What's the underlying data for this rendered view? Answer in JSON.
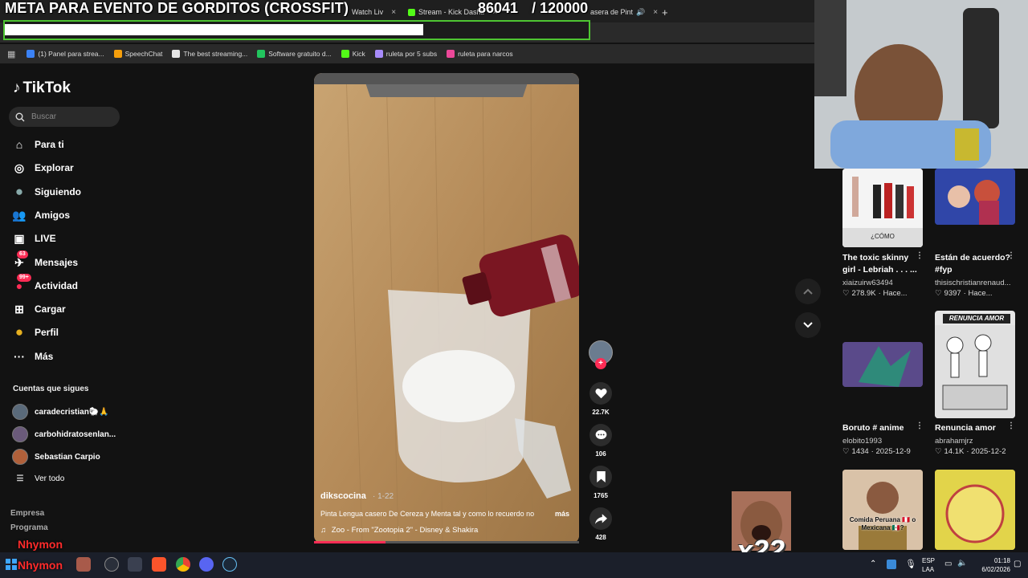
{
  "overlay": {
    "goal_title": "META PARA EVENTO DE GORDITOS (CROSSFIT)",
    "goal_current": "86041",
    "goal_separator": "/",
    "goal_target": "120000",
    "goal_progress": 0.717,
    "combo": "x22",
    "user_name": "Nhymon"
  },
  "browser": {
    "tabs": [
      {
        "label": "Watch Liv",
        "close": "×"
      },
      {
        "label": "Stream - Kick Dashb",
        "close": "×"
      },
      {
        "label": "asera de Pint",
        "close": "×"
      }
    ],
    "new_tab": "+",
    "bookmarks": [
      {
        "label": "(1) Panel para strea...",
        "color": "#3b82f6"
      },
      {
        "label": "SpeechChat",
        "color": "#f59e0b"
      },
      {
        "label": "The best streaming...",
        "color": "#e5e5e5"
      },
      {
        "label": "Software gratuito d...",
        "color": "#22c55e"
      },
      {
        "label": "Kick",
        "color": "#53fc18"
      },
      {
        "label": "ruleta por 5 subs",
        "color": "#a78bfa"
      },
      {
        "label": "ruleta para narcos",
        "color": "#ec4899"
      }
    ]
  },
  "tiktok": {
    "logo": "TikTok",
    "search_placeholder": "Buscar",
    "nav": [
      {
        "label": "Para ti",
        "icon": "home-icon"
      },
      {
        "label": "Explorar",
        "icon": "compass-icon"
      },
      {
        "label": "Siguiendo",
        "icon": "following-avatar-icon"
      },
      {
        "label": "Amigos",
        "icon": "friends-icon"
      },
      {
        "label": "LIVE",
        "icon": "live-icon"
      },
      {
        "label": "Mensajes",
        "icon": "messages-icon",
        "badge": "63"
      },
      {
        "label": "Actividad",
        "icon": "activity-icon",
        "badge": "99+"
      },
      {
        "label": "Cargar",
        "icon": "upload-icon"
      },
      {
        "label": "Perfil",
        "icon": "profile-icon"
      },
      {
        "label": "Más",
        "icon": "more-icon"
      }
    ],
    "following_heading": "Cuentas que sigues",
    "following": [
      {
        "name": "caradecristian🐑🙏"
      },
      {
        "name": "carbohidratosenlan..."
      },
      {
        "name": "Sebastian Carpio"
      }
    ],
    "see_all": "Ver todo",
    "footer": [
      "Empresa",
      "Programa"
    ],
    "video": {
      "author": "dikscocina",
      "date": "· 1-22",
      "description": "Pinta Lengua casero De Cereza y Menta tal y como lo recuerdo no",
      "more": "más",
      "music": "Zoo - From \"Zootopia 2\" - Disney & Shakira",
      "progress": 0.27,
      "likes": "22.7K",
      "comments": "106",
      "saves": "1765",
      "shares": "428"
    },
    "suggestions": [
      {
        "title": "The toxic skinny girl - Lebriah . . . ...",
        "user": "xiaizuirw63494",
        "likes": "278.9K",
        "time": "· Hace...",
        "caption": "¿CÓMO"
      },
      {
        "title": "Están de acuerdo? #fyp",
        "user": "thisischristianrenaud...",
        "likes": "9397",
        "time": "· Hace..."
      },
      {
        "title": "Boruto # anime",
        "user": "elobito1993",
        "likes": "1434",
        "time": "· 2025-12-9"
      },
      {
        "title": "Renuncia amor",
        "user": "abrahamjrz",
        "likes": "14.1K",
        "time": "· 2025-12-2",
        "caption": "RENUNCIA AMOR"
      },
      {
        "caption": "Comida Peruana 🇵🇪 o Mexicana 🇲🇽?"
      }
    ]
  },
  "taskbar": {
    "lang1": "ESP",
    "lang2": "LAA",
    "time": "01:18",
    "date": "6/02/2026"
  }
}
